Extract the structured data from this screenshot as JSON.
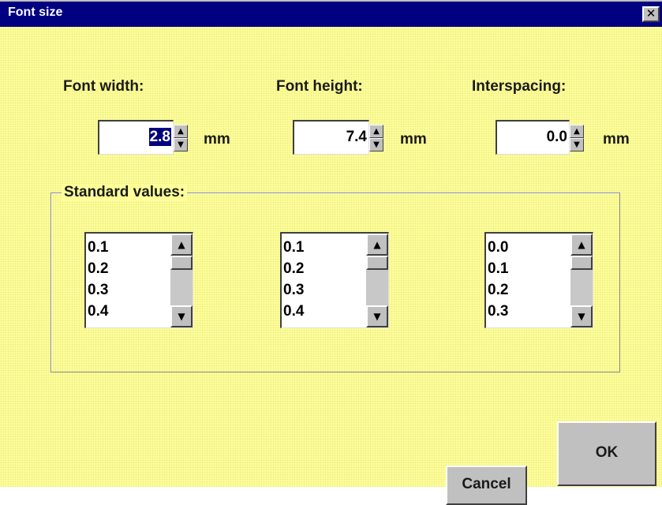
{
  "window": {
    "title": "Font size",
    "close_glyph": "✕",
    "background_color": "#ffff99",
    "titlebar_color": "#000080"
  },
  "fields": {
    "width": {
      "label": "Font width:",
      "value": "2.8",
      "unit": "mm",
      "value_selected": true
    },
    "height": {
      "label": "Font height:",
      "value": "7.4",
      "unit": "mm"
    },
    "spacing": {
      "label": "Interspacing:",
      "value": "0.0",
      "unit": "mm"
    }
  },
  "spin_icons": {
    "up": "▲",
    "down": "▼"
  },
  "standard_values": {
    "label": "Standard values:",
    "lists": [
      {
        "items": [
          "0.1",
          "0.2",
          "0.3",
          "0.4"
        ]
      },
      {
        "items": [
          "0.1",
          "0.2",
          "0.3",
          "0.4"
        ]
      },
      {
        "items": [
          "0.0",
          "0.1",
          "0.2",
          "0.3"
        ]
      }
    ]
  },
  "scroll_icons": {
    "up": "▲",
    "down": "▼"
  },
  "buttons": {
    "cancel": "Cancel",
    "ok": "OK"
  }
}
